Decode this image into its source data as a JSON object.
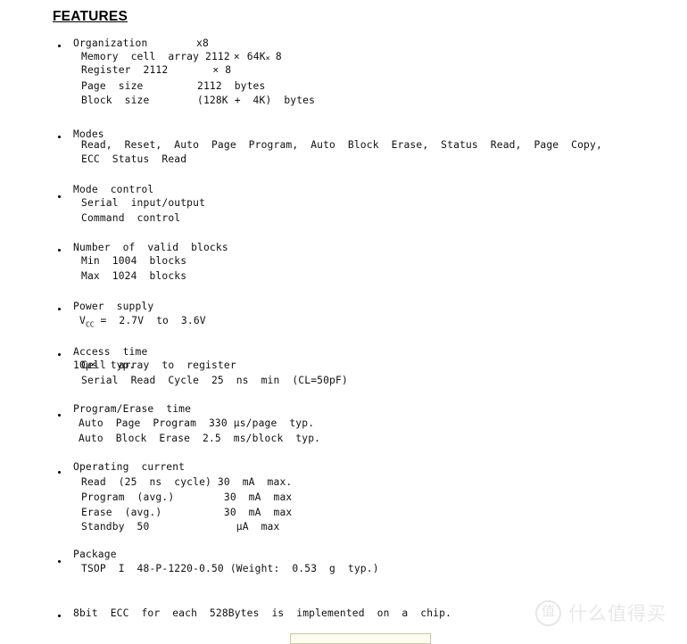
{
  "document": {
    "heading": "FEATURES",
    "sections": [
      {
        "id": "organization",
        "title": "Organization",
        "title_value": "x8",
        "lines": [
          "Memory  cell  array 2112",
          "Register  2112",
          "Page  size",
          "Block  size"
        ],
        "values": [
          "64K",
          "8",
          "2112  bytes",
          "(128K +  4K)  bytes"
        ]
      },
      {
        "id": "modes",
        "title": "Modes",
        "lines": [
          "Read,  Reset,  Auto  Page  Program,  Auto  Block  Erase,  Status  Read,  Page  Copy,",
          "ECC  Status  Read"
        ]
      },
      {
        "id": "mode-control",
        "title": "Mode  control",
        "lines": [
          "Serial  input/output",
          "Command  control"
        ]
      },
      {
        "id": "valid-blocks",
        "title": "Number  of  valid  blocks",
        "lines": [
          "Min  1004  blocks",
          "Max  1024  blocks"
        ]
      },
      {
        "id": "power-supply",
        "title": "Power  supply",
        "lines": [
          "VCC =  2.7V  to  3.6V"
        ]
      },
      {
        "id": "access-time",
        "title": "Access  time",
        "lines": [
          "Cell  array  to  register",
          "Serial  Read  Cycle  25  ns  min  (CL=50pF)"
        ],
        "overlap_text": "10 µs  typ."
      },
      {
        "id": "program-erase-time",
        "title": "Program/Erase  time",
        "lines": [
          "Auto  Page  Program  330 µs/page  typ.",
          "Auto  Block  Erase  2.5  ms/block  typ."
        ]
      },
      {
        "id": "operating-current",
        "title": "Operating  current",
        "lines": [
          "Read  (25  ns  cycle) 30  mA  max.",
          "Program  (avg.)        30  mA  max",
          "Erase  (avg.)          30  mA  max",
          "Standby  50              µA  max"
        ]
      },
      {
        "id": "package",
        "title": "Package",
        "lines": [
          "TSOP  I  48-P-1220-0.50 (Weight:  0.53  g  typ.)"
        ]
      },
      {
        "id": "ecc",
        "title": "8bit  ECC  for  each  528Bytes  is  implemented  on  a  chip.",
        "lines": []
      }
    ]
  },
  "organization_detail": {
    "line1_prefix": "Memory  cell  array 2112",
    "line1_times": "×",
    "line1_64k": "64K",
    "line1_times2": "×",
    "line1_8": "8",
    "line2_prefix": "Register  2112",
    "line2_times": "×",
    "line2_8": "8",
    "line3": "Page  size",
    "line3_val": "2112  bytes",
    "line4": "Block  size",
    "line4_val": "(128K +  4K)  bytes",
    "title_value": "x8"
  },
  "power_detail": {
    "v": "V",
    "cc": "CC",
    "rest": " =  2.7V  to  3.6V"
  },
  "access_detail": {
    "base": "Cell  array  to  register",
    "overlay": "10µs  typ.",
    "line2": "Serial  Read  Cycle  25  ns  min  (CL=50pF)"
  },
  "watermark": {
    "badge": "值",
    "text": "什么值得买"
  },
  "colors": {
    "background": "#ffffff",
    "text": "#111111",
    "watermark": "#e8e8e8",
    "box_fill": "#fdfdee",
    "box_border": "#cdc9a5"
  }
}
